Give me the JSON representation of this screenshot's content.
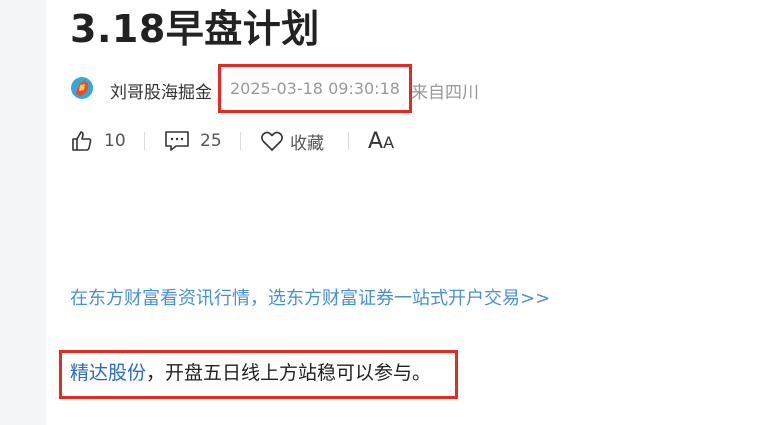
{
  "article": {
    "title": "3.18早盘计划",
    "author": "刘哥股海掘金",
    "datetime": "2025-03-18 09:30:18",
    "location": "来自四川"
  },
  "actions": {
    "like_count": "10",
    "comment_count": "25",
    "favorite_label": "收藏",
    "font_large": "A",
    "font_small": "A"
  },
  "promo_link": "在东方财富看资讯行情，选东方财富证券一站式开户交易>>",
  "content": {
    "stock_name": "精达股份",
    "text": "，开盘五日线上方站稳可以参与。"
  },
  "colors": {
    "highlight_box": "#e32a23",
    "link": "#4a90d9",
    "stock_link": "#2a6ac6"
  },
  "icons": [
    "avatar",
    "thumbs-up-icon",
    "comment-icon",
    "heart-icon",
    "font-size-icon"
  ]
}
